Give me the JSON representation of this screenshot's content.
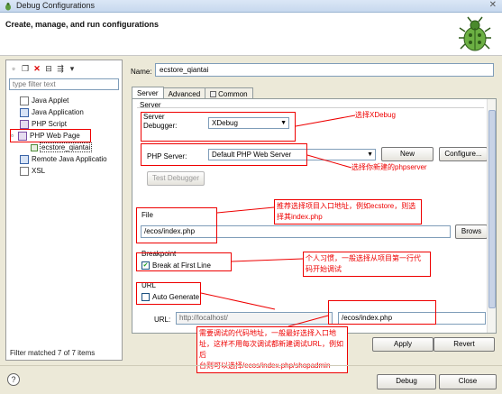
{
  "window": {
    "title": "Debug Configurations",
    "close_glyph": "✕"
  },
  "header": {
    "title": "Create, manage, and run configurations"
  },
  "left": {
    "filter_placeholder": "type filter text",
    "tree": [
      {
        "label": "Java Applet",
        "icon": "java-applet-icon",
        "indent": 1
      },
      {
        "label": "Java Application",
        "icon": "java-application-icon",
        "indent": 1
      },
      {
        "label": "PHP Script",
        "icon": "php-script-icon",
        "indent": 1
      },
      {
        "label": "PHP Web Page",
        "icon": "php-web-page-icon",
        "indent": 0,
        "expanded": true
      },
      {
        "label": "ecstore_qiantai",
        "icon": "php-config-icon",
        "indent": 2,
        "selected": true
      },
      {
        "label": "Remote Java Applicatio",
        "icon": "remote-java-icon",
        "indent": 1
      },
      {
        "label": "XSL",
        "icon": "xsl-icon",
        "indent": 1
      }
    ],
    "status": "Filter matched 7 of 7 items"
  },
  "form": {
    "name_label": "Name:",
    "name_value": "ecstore_qiantai",
    "tabs": [
      {
        "label": "Server",
        "active": true
      },
      {
        "label": "Advanced",
        "active": false
      },
      {
        "label": "Common",
        "active": false
      }
    ],
    "server_group": "Server",
    "server_debugger_label": "Server\nDebugger:",
    "server_debugger_value": "XDebug",
    "php_server_label": "PHP Server:",
    "php_server_value": "Default PHP Web Server",
    "new_button": "New",
    "configure_button": "Configure...",
    "test_debugger_button": "Test Debugger",
    "file_label": "File",
    "file_value": "/ecos/index.php",
    "browse_button": "Brows",
    "breakpoint_label": "Breakpoint",
    "break_first_line": "Break at First Line",
    "break_first_line_checked": true,
    "url_label": "URL",
    "auto_generate": "Auto Generate",
    "auto_generate_checked": false,
    "url_field_label": "URL:",
    "url_base": "http://localhost/",
    "url_path": "/ecos/index.php",
    "apply_button": "Apply",
    "revert_button": "Revert"
  },
  "annotations": {
    "xdebug": "选择XDebug",
    "phpserver": "选择你新建的phpserver",
    "file_l1": "推荐选择项目入口地址，例如ecstore，则选",
    "file_l2": "择其index.php",
    "bp_l1": "个人习惯，一般选择从项目第一行代",
    "bp_l2": "码开始调试",
    "url_l1": "需要调试的代码地址，一般最好选择入口地",
    "url_l2": "址，这样不用每次调试都新建调试URL，例如后",
    "url_l3": "台则可以选择/ecos/index.php/shopadmin"
  },
  "bottom": {
    "help_icon": "?",
    "debug_button": "Debug",
    "close_button": "Close"
  },
  "colors": {
    "annotation": "#e00000",
    "selection_box": "#e00000"
  }
}
